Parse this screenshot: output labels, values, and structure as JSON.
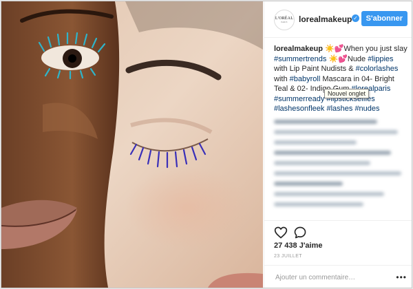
{
  "post": {
    "username": "lorealmakeup",
    "avatar_text": "L'ORÉAL",
    "avatar_sub": "PARIS",
    "verified_icon": "verified-check-icon",
    "follow_label": "S'abonner",
    "caption": {
      "author": "lorealmakeup",
      "segments": [
        {
          "t": "text",
          "v": " ☀️💕When you just slay "
        },
        {
          "t": "tag",
          "v": "#summertrends"
        },
        {
          "t": "text",
          "v": " ☀️💕Nude "
        },
        {
          "t": "tag",
          "v": "#lippies"
        },
        {
          "t": "text",
          "v": " with Lip Paint Nudists & "
        },
        {
          "t": "tag",
          "v": "#colorlashes"
        },
        {
          "t": "text",
          "v": " with "
        },
        {
          "t": "tag",
          "v": "#babyroll"
        },
        {
          "t": "text",
          "v": " Mascara in 04- Bright Teal & 02- Indigo Gum "
        },
        {
          "t": "tag",
          "v": "#lorealparis"
        },
        {
          "t": "text",
          "v": " "
        },
        {
          "t": "tag",
          "v": "#summerready"
        },
        {
          "t": "text",
          "v": " "
        },
        {
          "t": "tag",
          "v": "#lipstickselfies"
        },
        {
          "t": "text",
          "v": " "
        },
        {
          "t": "tag",
          "v": "#lashesonfleek"
        },
        {
          "t": "text",
          "v": " "
        },
        {
          "t": "tag",
          "v": "#lashes"
        },
        {
          "t": "text",
          "v": " "
        },
        {
          "t": "tag",
          "v": "#nudes"
        }
      ]
    },
    "tooltip": "Nouvel onglet",
    "likes": "27 438 J'aime",
    "date": "23 JUILLET",
    "comment_placeholder": "Ajouter un commentaire…",
    "more_label": "•••"
  },
  "icons": {
    "like": "heart-icon",
    "comment": "comment-icon",
    "more": "more-options-icon"
  },
  "colors": {
    "accent": "#3897f0",
    "hashtag": "#003569",
    "text": "#262626",
    "muted": "#999999"
  }
}
